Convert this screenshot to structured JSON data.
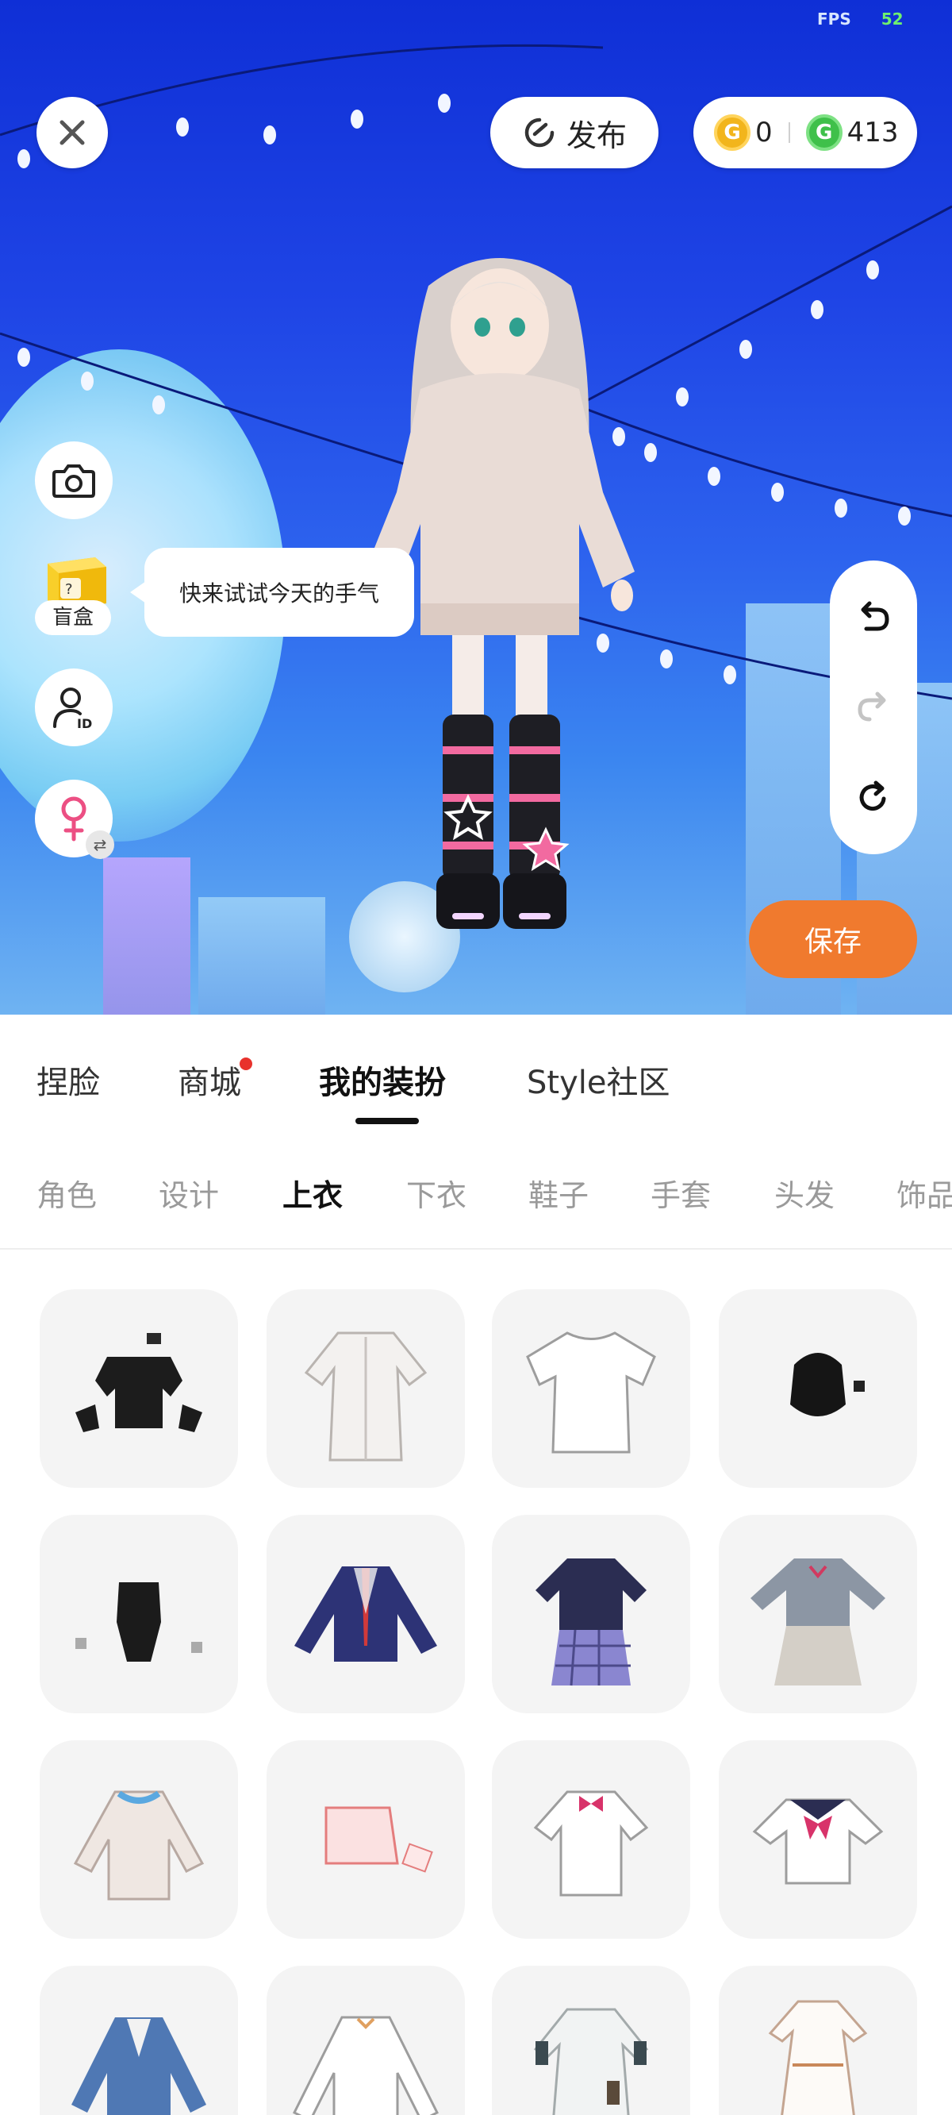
{
  "status": {
    "fps_label": "FPS",
    "fps_value": "52"
  },
  "top_bar": {
    "close_icon": "close-icon",
    "publish_label": "发布",
    "coins": {
      "gold_icon_letter": "G",
      "gold_value": "0",
      "green_icon_letter": "G",
      "green_value": "413"
    }
  },
  "side_tools": {
    "camera_icon": "camera-icon",
    "blindbox_label": "盲盒",
    "blindbox_tip": "快来试试今天的手气",
    "id_icon_text": "ID",
    "gender_icon": "female-icon",
    "gender_swap": "⇄"
  },
  "history": {
    "undo": "undo-icon",
    "redo": "redo-icon",
    "reset": "reset-icon"
  },
  "save_label": "保存",
  "main_tabs": [
    {
      "label": "捏脸",
      "active": false
    },
    {
      "label": "商城",
      "active": false,
      "dot": true
    },
    {
      "label": "我的装扮",
      "active": true
    },
    {
      "label": "Style社区",
      "active": false
    }
  ],
  "sub_tabs": [
    {
      "label": "角色"
    },
    {
      "label": "设计"
    },
    {
      "label": "上衣",
      "active": true
    },
    {
      "label": "下衣"
    },
    {
      "label": "鞋子"
    },
    {
      "label": "手套"
    },
    {
      "label": "头发"
    },
    {
      "label": "饰品"
    }
  ],
  "items": [
    "black-gothic-top",
    "white-long-coat",
    "white-tshirt",
    "black-hood",
    "black-bodysuit",
    "navy-school-blazer",
    "navy-plaid-dress",
    "grey-sailor-dress",
    "beige-cardigan",
    "pink-crop-top",
    "white-shirt-bow",
    "sailor-blouse-pink-bow",
    "blue-blazer",
    "white-puff-blouse",
    "white-lab-dress",
    "white-long-dress"
  ],
  "colors": {
    "save": "#f07a2e",
    "active_tab": "#111111",
    "dot": "#e8322c"
  }
}
